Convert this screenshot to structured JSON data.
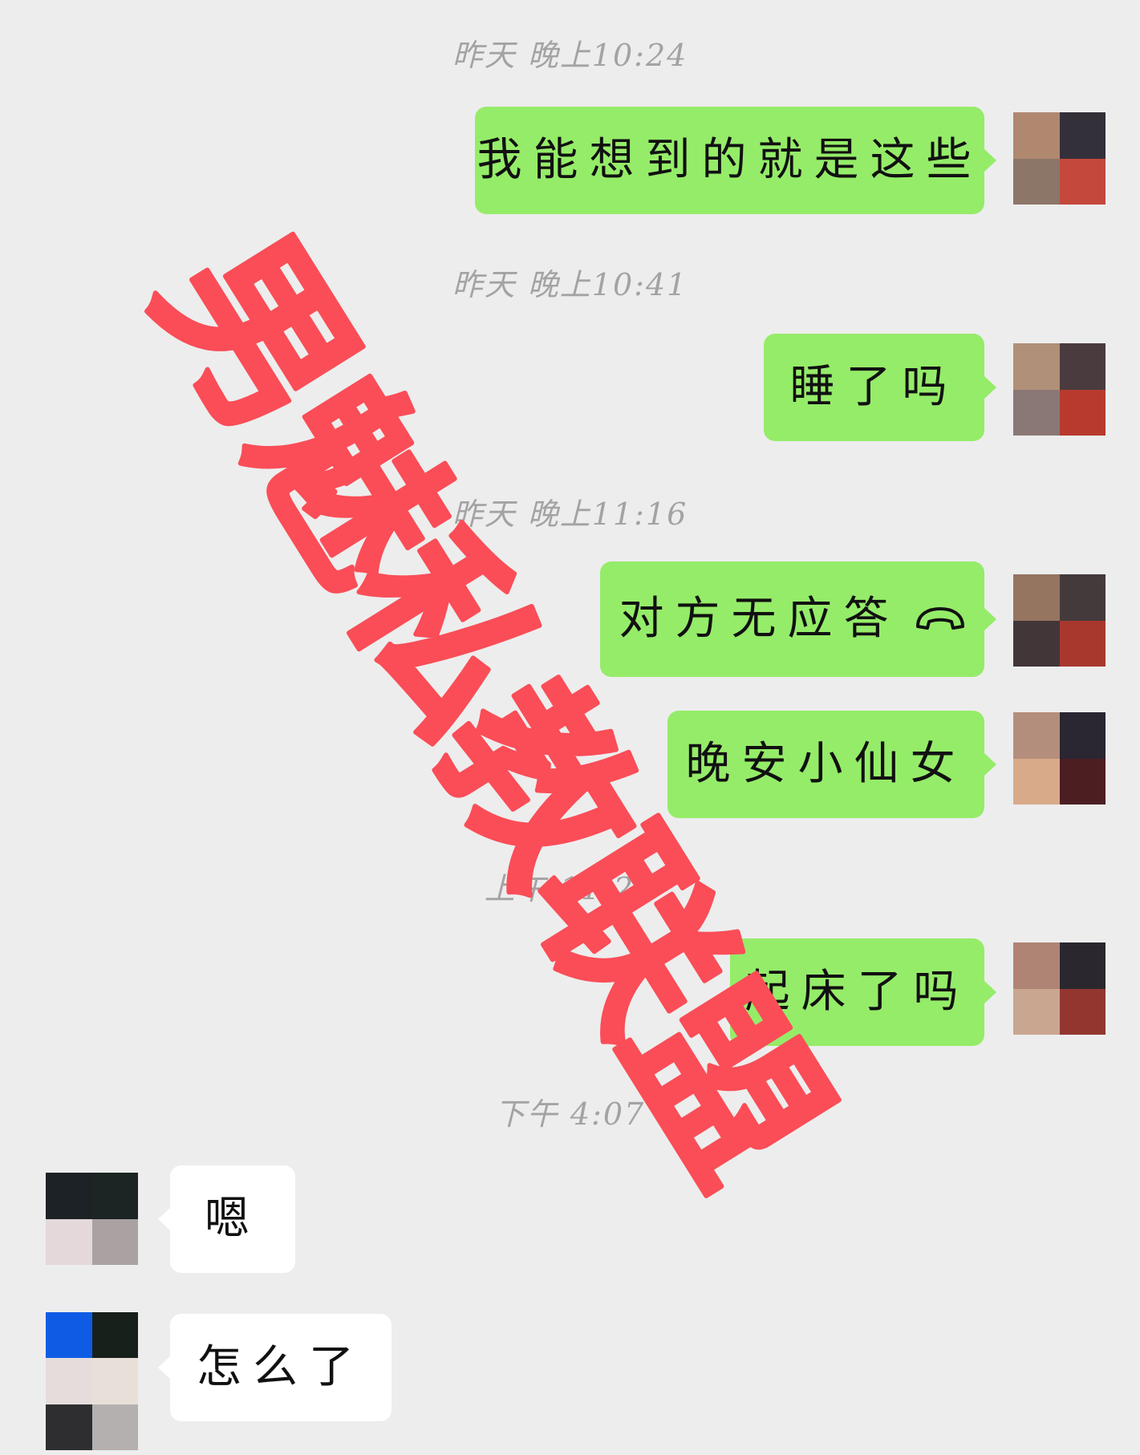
{
  "timestamps": [
    "昨天 晚上10:24",
    "昨天 晚上10:41",
    "昨天 晚上11:16",
    "上午 11:26",
    "下午 4:07"
  ],
  "messages": [
    {
      "text": "我能想到的就是这些",
      "direction": "sent"
    },
    {
      "text": "睡了吗",
      "direction": "sent"
    },
    {
      "text": "对方无应答",
      "direction": "sent",
      "icon": "phone-hangup-icon"
    },
    {
      "text": "晚安小仙女",
      "direction": "sent"
    },
    {
      "text": "起床了吗",
      "direction": "sent"
    },
    {
      "text": "嗯",
      "direction": "received"
    },
    {
      "text": "怎么了",
      "direction": "received"
    }
  ],
  "watermark": "男魅私教联盟",
  "colors": {
    "background": "#ededed",
    "sent_bubble": "#95ec69",
    "received_bubble": "#ffffff",
    "timestamp_text": "#a3a3a3",
    "watermark": "#fa4d57"
  },
  "avatars": {
    "me": [
      [
        "#b08870",
        "#34303a",
        "#8c7668",
        "#c4483c"
      ],
      [
        "#b09078",
        "#4a3c3e",
        "#8a7876",
        "#b83a2e"
      ],
      [
        "#957460",
        "#443a3c",
        "#433638",
        "#a8382e"
      ],
      [
        "#b48e7c",
        "#2a2632",
        "#d8aa8a",
        "#4c1e22"
      ],
      [
        "#b08474",
        "#2a282e",
        "#c9a690",
        "#943630"
      ]
    ],
    "contact_1": [
      "#1c2226",
      "#1c2424",
      "#e4d8da",
      "#aaa2a2"
    ],
    "contact_2": [
      "#0f5ce4",
      "#17201a",
      "#e6dcdc",
      "#e8e0d8",
      "#2e2e30",
      "#b4b0b0"
    ]
  }
}
